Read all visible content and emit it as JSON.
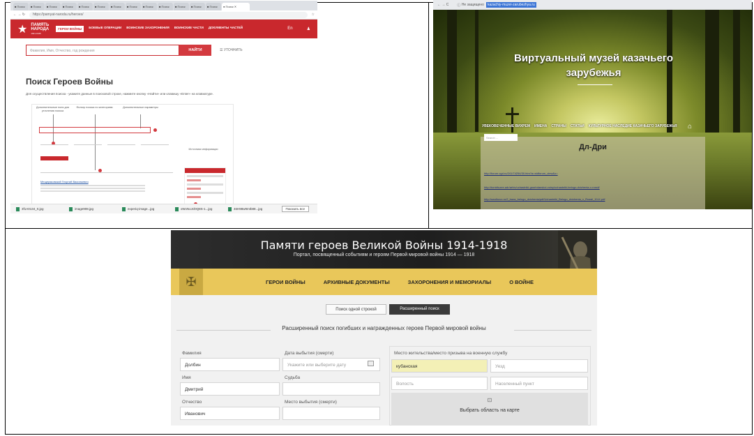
{
  "panel_a": {
    "browser_url": "https://pamyat-naroda.ru/heroes/",
    "logo_lines": [
      "ПАМЯТЬ",
      "НАРОДА",
      "1941-1945"
    ],
    "nav": [
      "ГЕРОИ ВОЙНЫ",
      "БОЕВЫЕ ОПЕРАЦИИ",
      "ВОИНСКИЕ ЗАХОРОНЕНИЯ",
      "ВОИНСКИЕ ЧАСТИ",
      "ДОКУМЕНТЫ ЧАСТЕЙ"
    ],
    "header_right": [
      "En",
      "♟"
    ],
    "search_placeholder": "Фамилия, Имя, Отчество, год рождения",
    "search_button": "НАЙТИ",
    "refine_label": "УТОЧНИТЬ",
    "page_title": "Поиск Героев Войны",
    "page_desc": "Для осуществления поиска - укажите данные в поисковой строке, нажмите кнопку «Найти» или клавишу «Enter» на клавиатуре.",
    "diagram_labels": [
      "Дополнительные поля для уточнения поиска",
      "Фильтр поиска по категориям",
      "Дополнительные параметры",
      "Источники информации"
    ],
    "diagram_result_link": "Мещеряковский Георгий Васильевич",
    "downloads": [
      "3f1A0134_0.jpg",
      "image908.jpg",
      "experiq-image...jpg",
      "xWoNoJcl0Q8S-1...jpg",
      "46H98w9mIb88...jpg"
    ],
    "show_all": "Показать все"
  },
  "panel_b": {
    "address_prefix": "Не защищено",
    "address_url": "kazachiy-muzei-zarubezhya.ru",
    "title": "Виртуальный музей казачьего зарубежья",
    "nav": [
      "УВЕКОВЕЧЕННЫЕ ВИХРЕМ",
      "ИМЕНА",
      "СТРАНЫ",
      "СТАТЬИ",
      "КУЛЬТУРНОЕ НАСЛЕДИЕ КАЗАЧЬЕГО ЗАРУБЕЖЬЯ"
    ],
    "search_placeholder": "Search ...",
    "heading": "Дл-Дри",
    "links": [
      "http://forum.vgd.ru/241/74254/30.htm?a=stdforum_view&o=",
      "http://tombfuzee.adr/arhiv/uchastniki-grazhdanskoi-voiny/uchastniki-belogo-dvizhenia-v-rossii/",
      "http://swolkovo.ru/2_baza_belogo_dvizhenia/pdf/Uchastniki_Belogo_dvizhenia_v_Rossii_10-K.pdf"
    ]
  },
  "panel_c": {
    "site_title": "Памяти героев Великой Войны 1914-1918",
    "site_subtitle": "Портал, посвященный событиям и героям Первой мировой войны 1914 — 1918",
    "nav": [
      "ГЕРОИ ВОЙНЫ",
      "АРХИВНЫЕ ДОКУМЕНТЫ",
      "ЗАХОРОНЕНИЯ И МЕМОРИАЛЫ",
      "О ВОЙНЕ"
    ],
    "tab_simple": "Поиск одной строкой",
    "tab_advanced": "Расширенный поиск",
    "form_title": "Расширенный поиск погибших и награжденных героев Первой мировой войны",
    "surname": {
      "label": "Фамилия",
      "value": "Долбин"
    },
    "name": {
      "label": "Имя",
      "value": "Дмитрий"
    },
    "patronymic": {
      "label": "Отчество",
      "value": "Иванович"
    },
    "death_date": {
      "label": "Дата выбытия (смерти)",
      "placeholder": "Укажите или выберите дату"
    },
    "fate": {
      "label": "Судьба"
    },
    "death_place": {
      "label": "Место выбытия (смерти)"
    },
    "residence": {
      "legend": "Место жительства/место призыва на военную службу",
      "province": "кубанская",
      "county": "Уезд",
      "volost": "Волость",
      "settlement": "Населенный пункт"
    },
    "map_icon": "⊡",
    "map_button": "Выбрать область на карте"
  }
}
